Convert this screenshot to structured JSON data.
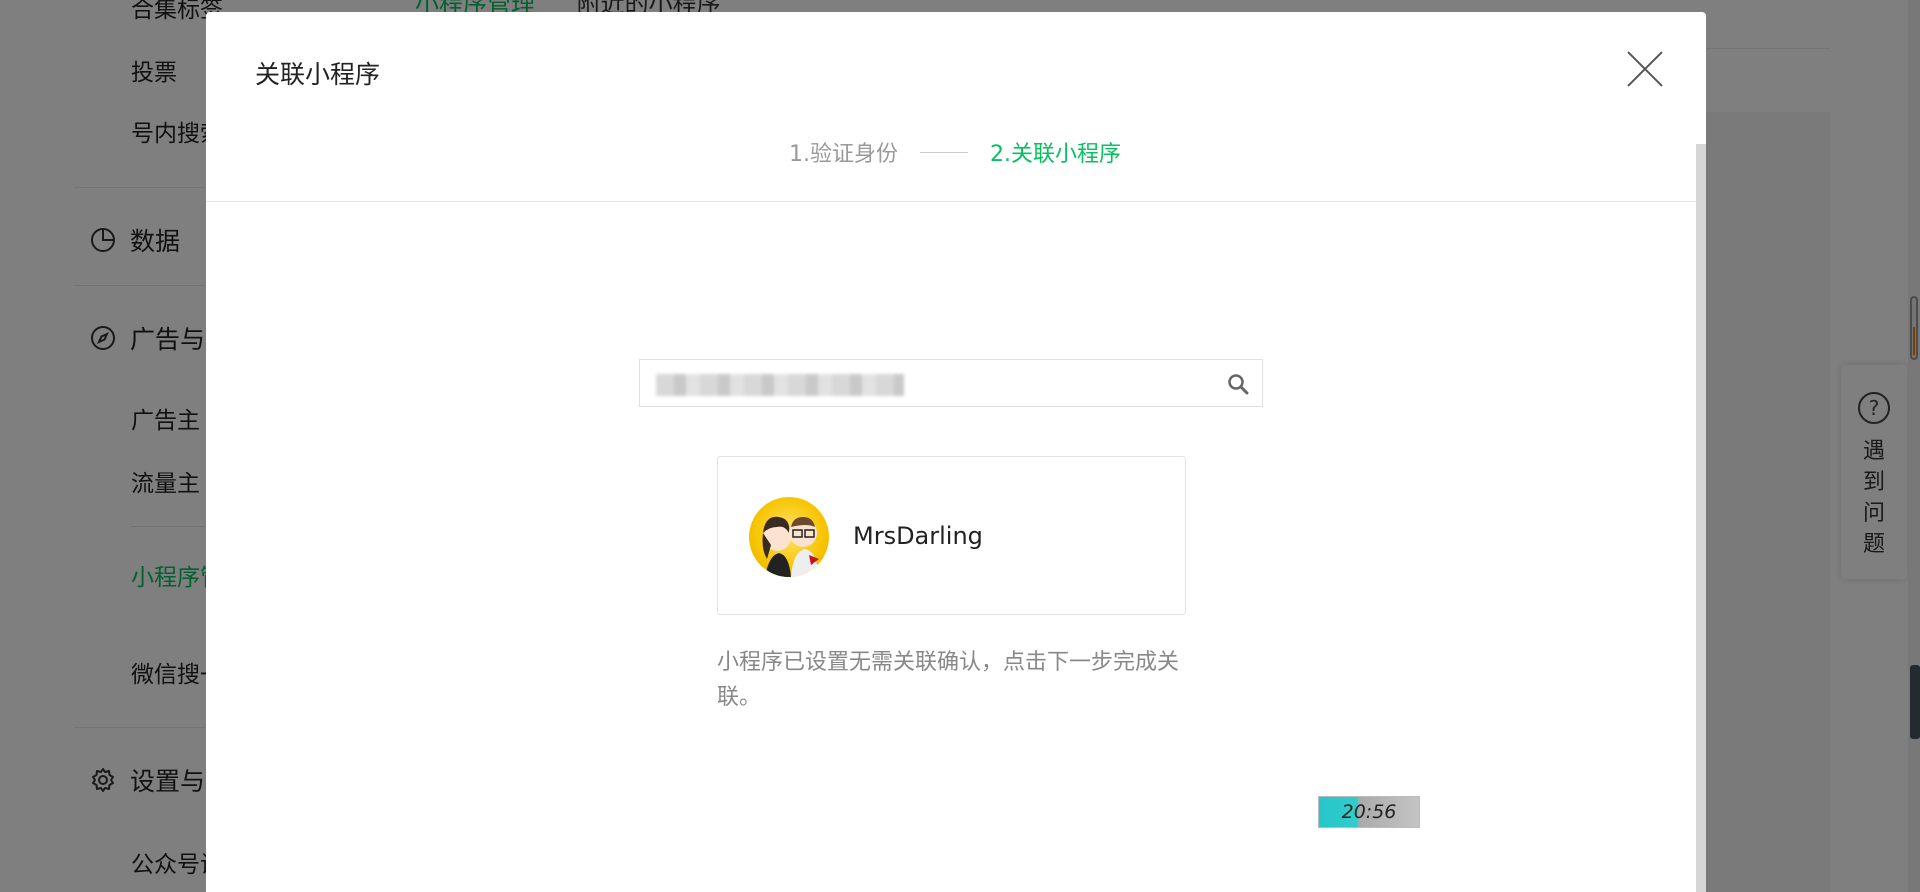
{
  "background": {
    "sidebar": {
      "item_top_cut": "合集标签",
      "item_vote": "投票",
      "item_search": "号内搜索",
      "group_data": "数据",
      "group_ads": "广告与",
      "item_advertiser": "广告主",
      "item_publisher": "流量主",
      "item_miniprogram": "小程序管",
      "item_wechat_search": "微信搜一",
      "group_settings": "设置与",
      "item_account": "公众号设"
    },
    "top_tabs": [
      "小程序管理",
      "附近的小程序"
    ],
    "help_float": {
      "label": "遇到问题"
    }
  },
  "modal": {
    "title": "关联小程序",
    "steps": {
      "step1": "1.验证身份",
      "step2": "2.关联小程序"
    },
    "search": {
      "value": ""
    },
    "result": {
      "name": "MrsDarling"
    },
    "hint": "小程序已设置无需关联确认，点击下一步完成关联。",
    "time_badge": "20:56"
  },
  "colors": {
    "accent": "#07c160",
    "overlay": "rgba(0,0,0,0.5)"
  },
  "icons": [
    "search-icon",
    "close-icon",
    "data-icon",
    "compass-icon",
    "gear-icon",
    "question-icon"
  ]
}
